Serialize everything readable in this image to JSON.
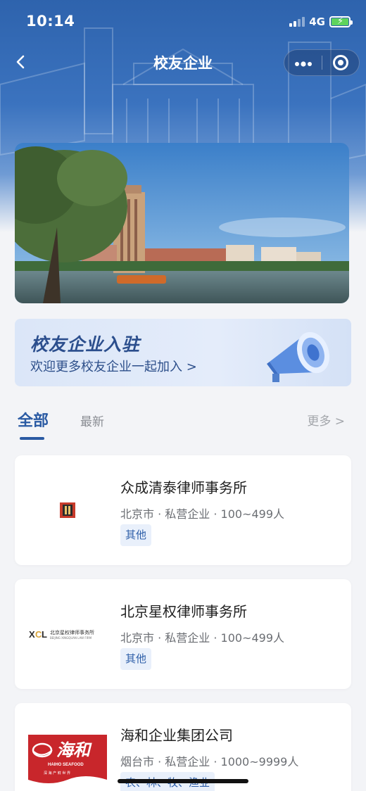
{
  "status_bar": {
    "time": "10:14",
    "network": "4G",
    "battery_percent": 100
  },
  "nav": {
    "title": "校友企业",
    "back_icon": "chevron-left-icon",
    "more_icon": "more-dots-icon",
    "close_icon": "target-close-icon"
  },
  "join_banner": {
    "title": "校友企业入驻",
    "subtitle": "欢迎更多校友企业一起加入 >"
  },
  "tabs": {
    "all": "全部",
    "latest": "最新",
    "more": "更多 >"
  },
  "companies": [
    {
      "name": "众成清泰律师事务所",
      "meta": "北京市 · 私营企业 · 100~499人",
      "tag": "其他"
    },
    {
      "name": "北京星权律师事务所",
      "meta": "北京市 · 私营企业 · 100~499人",
      "tag": "其他",
      "logo_text": "北京星权律师事务所",
      "logo_sub": "BEIJING XINGQUAN LAW FIRM"
    },
    {
      "name": "海和企业集团公司",
      "meta": "烟台市 · 私营企业 · 1000~9999人",
      "tag": "农、林、牧、渔业",
      "logo_text": "海和",
      "logo_sub": "HAIHO SEAFOOD",
      "logo_tagline": "深 海 产 鲜 世 界"
    }
  ],
  "colors": {
    "primary": "#2a5aa3",
    "header": "#2e63ad",
    "tag_bg": "#e9f0fb",
    "haiho_red": "#c8262b"
  }
}
